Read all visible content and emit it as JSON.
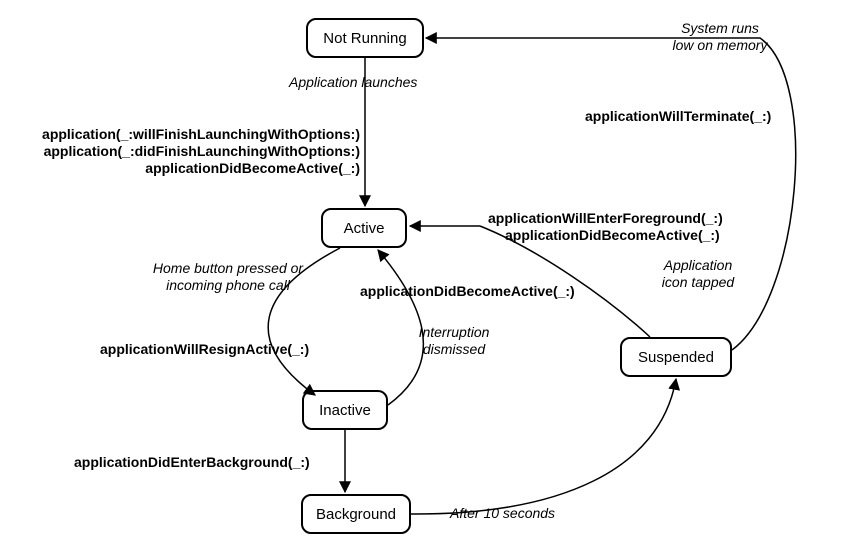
{
  "nodes": {
    "not_running": "Not Running",
    "active": "Active",
    "inactive": "Inactive",
    "background": "Background",
    "suspended": "Suspended"
  },
  "labels": {
    "system_low_memory": "System runs\nlow on memory",
    "application_launches": "Application launches",
    "will_terminate": "applicationWillTerminate(_:)",
    "launch_callbacks_1": "application(_:willFinishLaunchingWithOptions:)",
    "launch_callbacks_2": "application(_:didFinishLaunchingWithOptions:)",
    "launch_callbacks_3": "applicationDidBecomeActive(_:)",
    "enter_fg_1": "applicationWillEnterForeground(_:)",
    "enter_fg_2": "applicationDidBecomeActive(_:)",
    "home_button": "Home button pressed or\nincoming phone call",
    "did_become_active": "applicationDidBecomeActive(_:)",
    "app_icon_tapped": "Application\nicon tapped",
    "will_resign_active": "applicationWillResignActive(_:)",
    "interruption_dismissed": "Interruption\ndismissed",
    "did_enter_background": "applicationDidEnterBackground(_:)",
    "after_10s": "After 10 seconds"
  },
  "chart_data": {
    "type": "state_diagram",
    "states": [
      "Not Running",
      "Active",
      "Inactive",
      "Background",
      "Suspended"
    ],
    "transitions": [
      {
        "from": "Not Running",
        "to": "Active",
        "trigger": "Application launches",
        "callbacks": [
          "application(_:willFinishLaunchingWithOptions:)",
          "application(_:didFinishLaunchingWithOptions:)",
          "applicationDidBecomeActive(_:)"
        ]
      },
      {
        "from": "Active",
        "to": "Inactive",
        "trigger": "Home button pressed or incoming phone call",
        "callbacks": [
          "applicationWillResignActive(_:)"
        ]
      },
      {
        "from": "Inactive",
        "to": "Active",
        "trigger": "Interruption dismissed",
        "callbacks": [
          "applicationDidBecomeActive(_:)"
        ]
      },
      {
        "from": "Inactive",
        "to": "Background",
        "callbacks": [
          "applicationDidEnterBackground(_:)"
        ]
      },
      {
        "from": "Background",
        "to": "Suspended",
        "trigger": "After 10 seconds"
      },
      {
        "from": "Suspended",
        "to": "Active",
        "trigger": "Application icon tapped",
        "callbacks": [
          "applicationWillEnterForeground(_:)",
          "applicationDidBecomeActive(_:)"
        ]
      },
      {
        "from": "Suspended",
        "to": "Not Running",
        "trigger": "System runs low on memory",
        "callbacks": [
          "applicationWillTerminate(_:)"
        ]
      }
    ]
  }
}
